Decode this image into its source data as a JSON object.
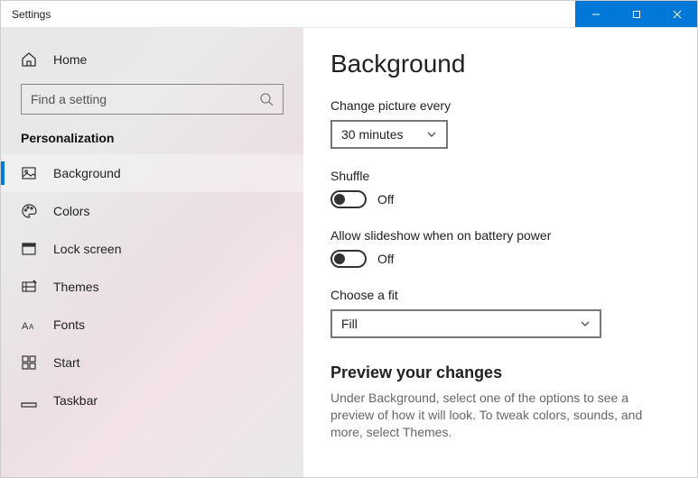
{
  "window": {
    "title": "Settings"
  },
  "sidebar": {
    "home_label": "Home",
    "search_placeholder": "Find a setting",
    "section_label": "Personalization",
    "items": [
      {
        "label": "Background"
      },
      {
        "label": "Colors"
      },
      {
        "label": "Lock screen"
      },
      {
        "label": "Themes"
      },
      {
        "label": "Fonts"
      },
      {
        "label": "Start"
      },
      {
        "label": "Taskbar"
      }
    ]
  },
  "page": {
    "title": "Background",
    "change_picture_label": "Change picture every",
    "change_picture_value": "30 minutes",
    "shuffle_label": "Shuffle",
    "shuffle_value": "Off",
    "battery_label": "Allow slideshow when on battery power",
    "battery_value": "Off",
    "fit_label": "Choose a fit",
    "fit_value": "Fill",
    "preview_heading": "Preview your changes",
    "preview_desc": "Under Background, select one of the options to see a preview of how it will look. To tweak colors, sounds, and more, select Themes."
  }
}
